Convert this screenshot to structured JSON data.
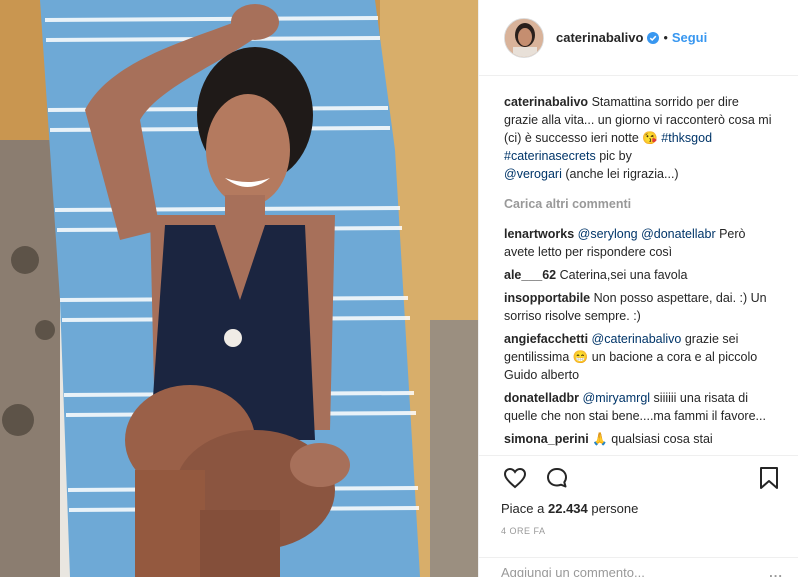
{
  "post": {
    "image_alt": "Photo of a woman smiling, lying on a blue striped towel"
  },
  "header": {
    "username": "caterinabalivo",
    "separator": "•",
    "follow_label": "Segui"
  },
  "caption": {
    "username": "caterinabalivo",
    "text": "Stamattina sorrido per dire grazie alla vita... un giorno vi racconterò cosa mi (ci) è successo ieri notte 😘",
    "hashtag1": "#thksgod",
    "hashtag2": "#caterinasecrets",
    "pic_by": "pic by",
    "mention": "@verogari",
    "tail": "(anche lei rigrazia...)"
  },
  "load_more_label": "Carica altri commenti",
  "comments": [
    {
      "user": "lenartworks",
      "mentions": "@serylong @donatellabr",
      "text": "Però avete letto per rispondere così"
    },
    {
      "user": "ale___62",
      "mentions": "",
      "text": "Caterina,sei una favola"
    },
    {
      "user": "insopportabile",
      "mentions": "",
      "text": "Non posso aspettare, dai. :) Un sorriso risolve sempre. :)"
    },
    {
      "user": "angiefacchetti",
      "mentions": "@caterinabalivo",
      "text": "grazie sei gentilissima 😁 un bacione a cora e al piccolo Guido alberto"
    },
    {
      "user": "donatelladbr",
      "mentions": "@miryamrgl",
      "text": "siiiiii una risata di quelle che non stai bene....ma fammi il favore..."
    },
    {
      "user": "simona_perini",
      "mentions": "",
      "text": "🙏 qualsiasi cosa stai"
    }
  ],
  "actions": {
    "likes_prefix": "Piace a",
    "likes_count": "22.434",
    "likes_suffix": "persone",
    "time_ago": "4 ORE FA"
  },
  "add_comment": {
    "placeholder": "Aggiungi un commento...",
    "more": "..."
  },
  "colors": {
    "link_blue": "#3897f0",
    "mention_blue": "#003569",
    "muted": "#999999",
    "verified": "#3897f0"
  }
}
